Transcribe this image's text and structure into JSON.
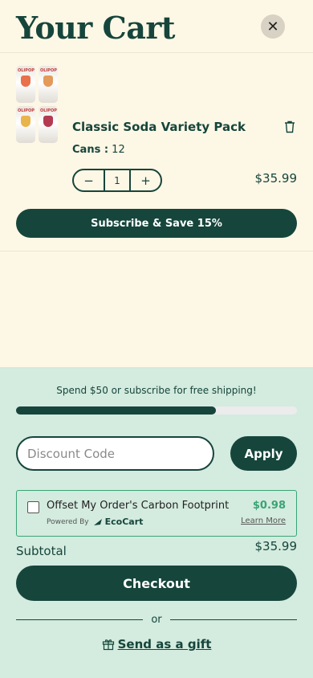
{
  "header": {
    "title": "Your Cart",
    "close_icon": "close-icon"
  },
  "cart": {
    "items": [
      {
        "name": "Classic Soda Variety Pack",
        "option_label": "Cans :",
        "option_value": "12",
        "quantity": "1",
        "minus": "−",
        "plus": "+",
        "price": "$35.99",
        "subscribe_label": "Subscribe & Save 15%",
        "can_labels": [
          "OLIPOP",
          "OLIPOP",
          "OLIPOP",
          "OLIPOP"
        ]
      }
    ]
  },
  "footer": {
    "shipping_message": "Spend $50 or subscribe for free shipping!",
    "shipping_progress": 0.71,
    "discount_placeholder": "Discount Code",
    "apply_label": "Apply",
    "eco": {
      "label": "Offset My Order's Carbon Footprint",
      "amount": "$0.98",
      "powered_by": "Powered By",
      "brand": "EcoCart",
      "learn_more": "Learn More"
    },
    "subtotal_label": "Subtotal",
    "subtotal_value": "$35.99",
    "checkout_label": "Checkout",
    "or_label": "or",
    "gift_label": "Send as a gift"
  },
  "colors": {
    "brand": "#16453b",
    "cream": "#fdf7e6",
    "mint": "#d4ebdf",
    "eco_green": "#3aa474"
  }
}
